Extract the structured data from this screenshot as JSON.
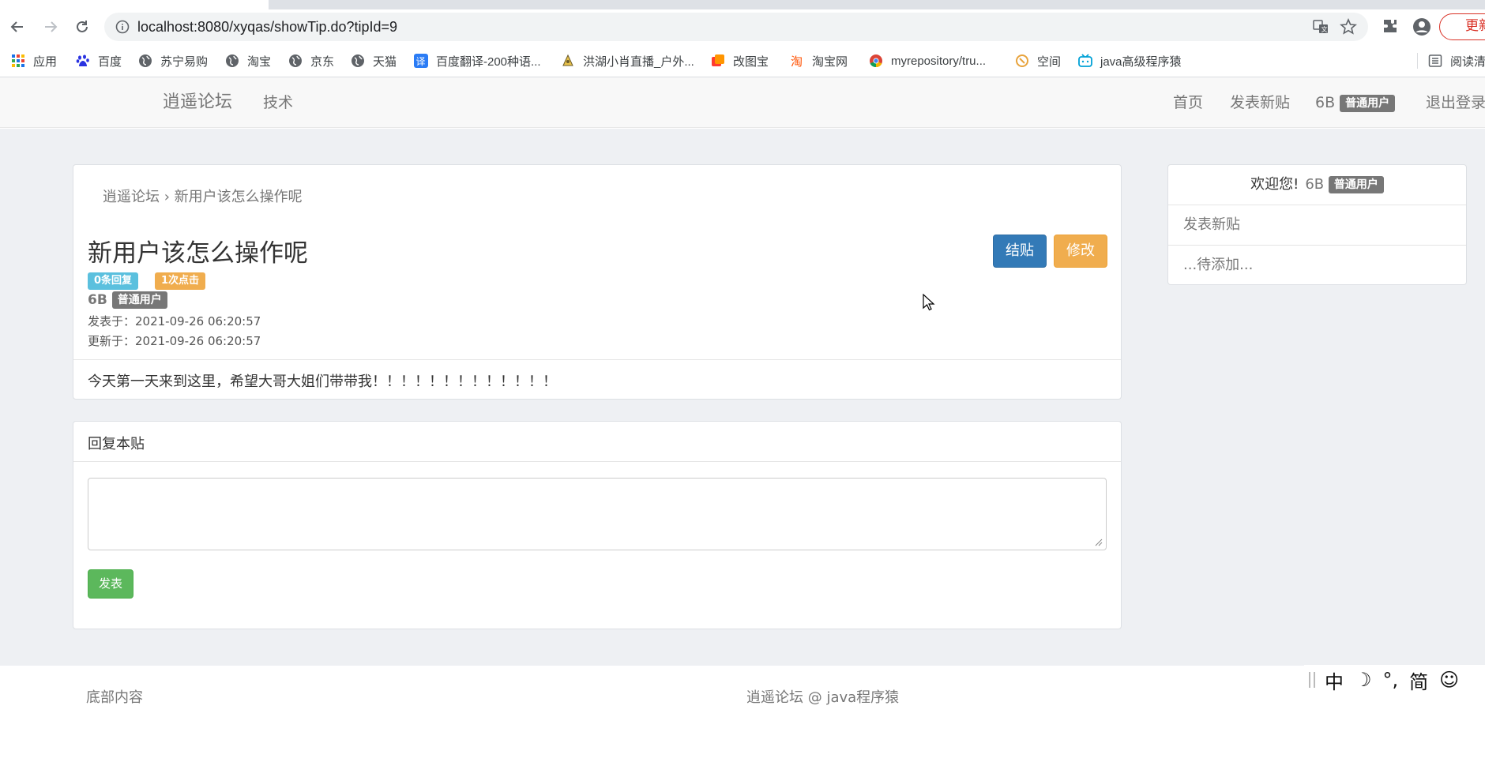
{
  "browser": {
    "url": "localhost:8080/xyqas/showTip.do?tipId=9",
    "update_label": "更新",
    "bookmarks": [
      {
        "label": "应用",
        "icon": "apps-grid-icon"
      },
      {
        "label": "百度",
        "icon": "baidu-paw-icon"
      },
      {
        "label": "苏宁易购",
        "icon": "globe-icon"
      },
      {
        "label": "淘宝",
        "icon": "globe-icon"
      },
      {
        "label": "京东",
        "icon": "globe-icon"
      },
      {
        "label": "天猫",
        "icon": "globe-icon"
      },
      {
        "label": "百度翻译-200种语...",
        "icon": "translate-icon"
      },
      {
        "label": "洪湖小肖直播_户外...",
        "icon": "live-icon"
      },
      {
        "label": "改图宝",
        "icon": "image-tool-icon"
      },
      {
        "label": "淘宝网",
        "icon": "taobao-icon"
      },
      {
        "label": "myrepository/tru...",
        "icon": "chrome-icon"
      },
      {
        "label": "空间",
        "icon": "qzone-icon"
      },
      {
        "label": "java高级程序猿",
        "icon": "bilibili-icon"
      }
    ],
    "reading_list_label": "阅读清单"
  },
  "navbar": {
    "brand": "逍遥论坛",
    "category": "技术",
    "links": {
      "home": "首页",
      "new_post": "发表新贴",
      "logout": "退出登录"
    },
    "username": "6B",
    "user_role": "普通用户"
  },
  "post": {
    "breadcrumb": "逍遥论坛 › 新用户该怎么操作呢",
    "title": "新用户该怎么操作呢",
    "replies_badge": "0条回复",
    "clicks_badge": "1次点击",
    "author": "6B",
    "author_role": "普通用户",
    "published": "发表于：2021-09-26 06:20:57",
    "updated": "更新于：2021-09-26 06:20:57",
    "close_label": "结贴",
    "edit_label": "修改",
    "content": "今天第一天来到这里，希望大哥大姐们带带我！！！！！！！！！！！！！"
  },
  "reply": {
    "heading": "回复本贴",
    "textarea_value": "",
    "submit_label": "发表"
  },
  "sidebar": {
    "welcome": "欢迎您!",
    "username": "6B",
    "role": "普通用户",
    "new_post": "发表新贴",
    "pending": "...待添加..."
  },
  "footer": {
    "left": "底部内容",
    "center": "逍遥论坛 @ java程序猿"
  },
  "ime": {
    "lang": "中",
    "moon": "☽",
    "punct": "°,",
    "script": "简",
    "emoji": "☺"
  },
  "colors": {
    "primary": "#337ab7",
    "warning": "#f0ad4e",
    "success": "#5cb85c",
    "info": "#5bc0de",
    "default_label": "#777777",
    "page_bg": "#eef0f3"
  }
}
